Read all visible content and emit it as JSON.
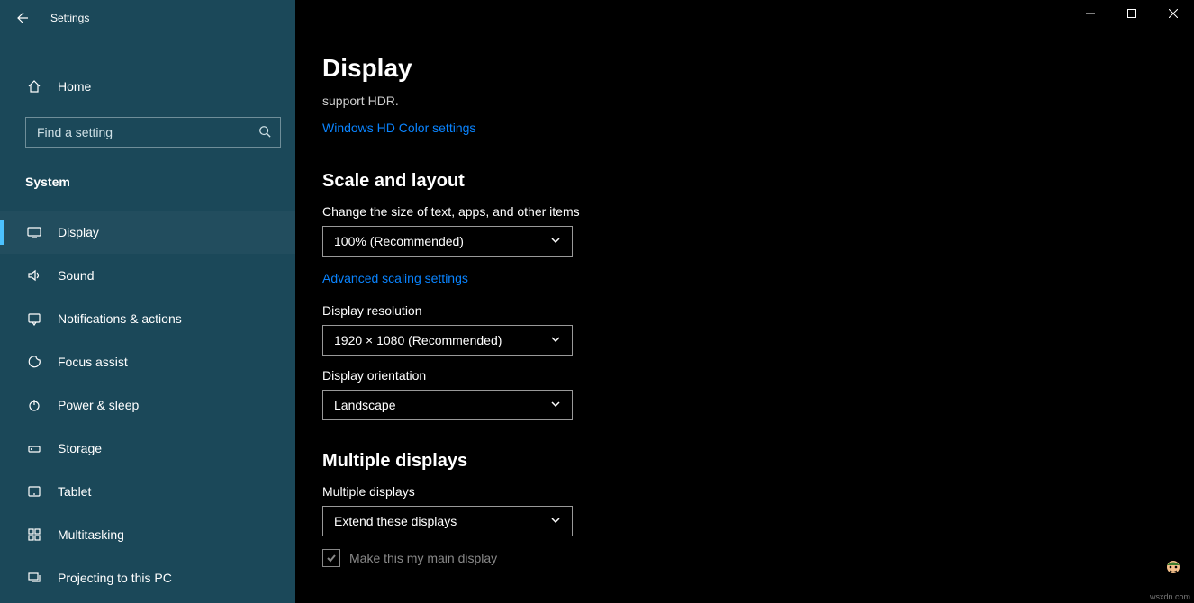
{
  "app": {
    "title": "Settings"
  },
  "sidebar": {
    "home_label": "Home",
    "search_placeholder": "Find a setting",
    "category_label": "System",
    "items": [
      {
        "label": "Display",
        "icon": "display"
      },
      {
        "label": "Sound",
        "icon": "sound"
      },
      {
        "label": "Notifications & actions",
        "icon": "notifications"
      },
      {
        "label": "Focus assist",
        "icon": "focus"
      },
      {
        "label": "Power & sleep",
        "icon": "power"
      },
      {
        "label": "Storage",
        "icon": "storage"
      },
      {
        "label": "Tablet",
        "icon": "tablet"
      },
      {
        "label": "Multitasking",
        "icon": "multitasking"
      },
      {
        "label": "Projecting to this PC",
        "icon": "projecting"
      }
    ]
  },
  "main": {
    "page_title": "Display",
    "hdr_fragment": "support HDR.",
    "hdr_link": "Windows HD Color settings",
    "scale_heading": "Scale and layout",
    "scale_label": "Change the size of text, apps, and other items",
    "scale_value": "100% (Recommended)",
    "advanced_scaling_link": "Advanced scaling settings",
    "resolution_label": "Display resolution",
    "resolution_value": "1920 × 1080 (Recommended)",
    "orientation_label": "Display orientation",
    "orientation_value": "Landscape",
    "multiple_heading": "Multiple displays",
    "multiple_label": "Multiple displays",
    "multiple_value": "Extend these displays",
    "main_display_checkbox": "Make this my main display"
  }
}
